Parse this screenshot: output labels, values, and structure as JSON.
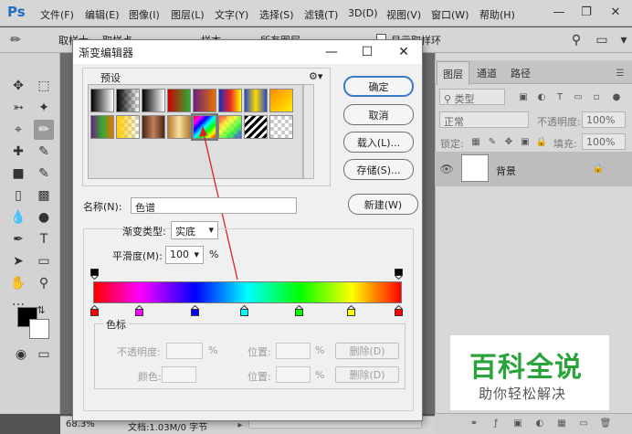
{
  "app": {
    "logo": "Ps"
  },
  "menu": [
    "文件(F)",
    "编辑(E)",
    "图像(I)",
    "图层(L)",
    "文字(Y)",
    "选择(S)",
    "滤镜(T)",
    "3D(D)",
    "视图(V)",
    "窗口(W)",
    "帮助(H)"
  ],
  "options_bar": {
    "sample_label": "取样大",
    "sample_value": "取样点",
    "sample2_label": "样本",
    "sample2_value": "所有图层",
    "show_ring": "显示取样环"
  },
  "dialog": {
    "title": "渐变编辑器",
    "presets_label": "预设",
    "buttons": {
      "ok": "确定",
      "cancel": "取消",
      "load": "载入(L)...",
      "save": "存储(S)...",
      "new": "新建(W)"
    },
    "name_label": "名称(N):",
    "name_value": "色谱",
    "gradient_type_label": "渐变类型:",
    "gradient_type_value": "实底",
    "smoothness_label": "平滑度(M):",
    "smoothness_value": "100",
    "smoothness_unit": "%",
    "stops_section": {
      "title": "色标",
      "opacity_label": "不透明度:",
      "opacity_unit": "%",
      "position_label": "位置:",
      "position_unit": "%",
      "delete_label": "删除(D)",
      "color_label": "颜色:",
      "position2_label": "位置:",
      "position2_unit": "%",
      "delete2_label": "删除(D)"
    },
    "color_stops": [
      "#ff0000",
      "#ff00ff",
      "#0000ff",
      "#00ffff",
      "#00ff00",
      "#ffff00",
      "#ff0000"
    ],
    "opacity_stops": 2
  },
  "panels": {
    "tabs": [
      "图层",
      "通道",
      "路径"
    ],
    "kind_filter": "类型",
    "blend_mode": "正常",
    "opacity_label": "不透明度:",
    "opacity_value": "100%",
    "lock_label": "锁定:",
    "fill_label": "填充:",
    "fill_value": "100%",
    "layer_name": "背景"
  },
  "status": {
    "zoom": "68.3%",
    "doc_info": "文档:1.03M/0 字节"
  },
  "watermark": {
    "title": "百科全说",
    "subtitle": "助你轻松解决"
  },
  "colors": {
    "accent": "#1f6fc5",
    "watermark_green": "#2aa43a"
  }
}
